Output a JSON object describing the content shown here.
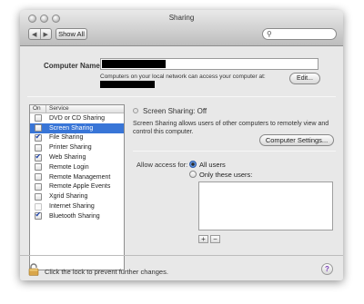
{
  "window": {
    "title": "Sharing"
  },
  "toolbar": {
    "back": "◀",
    "forward": "▶",
    "show_all_label": "Show All",
    "search_placeholder": ""
  },
  "computer_name": {
    "label": "Computer Name:",
    "help_text": "Computers on your local network can access your computer at:",
    "edit_label": "Edit..."
  },
  "services": {
    "header_on": "On",
    "header_service": "Service",
    "items": [
      {
        "label": "DVD or CD Sharing",
        "checked": false,
        "selected": false
      },
      {
        "label": "Screen Sharing",
        "checked": false,
        "selected": true
      },
      {
        "label": "File Sharing",
        "checked": true,
        "selected": false
      },
      {
        "label": "Printer Sharing",
        "checked": false,
        "selected": false
      },
      {
        "label": "Web Sharing",
        "checked": true,
        "selected": false
      },
      {
        "label": "Remote Login",
        "checked": false,
        "selected": false
      },
      {
        "label": "Remote Management",
        "checked": false,
        "selected": false
      },
      {
        "label": "Remote Apple Events",
        "checked": false,
        "selected": false
      },
      {
        "label": "Xgrid Sharing",
        "checked": false,
        "selected": false
      },
      {
        "label": "Internet Sharing",
        "checked": false,
        "selected": false
      },
      {
        "label": "Bluetooth Sharing",
        "checked": true,
        "selected": false
      }
    ]
  },
  "detail": {
    "status": "Screen Sharing: Off",
    "description": "Screen Sharing allows users of other computers to remotely view and control this computer.",
    "settings_label": "Computer Settings...",
    "allow_access_label": "Allow access for:",
    "option_all": "All users",
    "option_only": "Only these users:",
    "selected_option": "All users",
    "add_label": "+",
    "remove_label": "−"
  },
  "footer": {
    "lock_text": "Click the lock to prevent further changes.",
    "help_label": "?"
  },
  "colors": {
    "selection": "#3875d7",
    "check": "#1a3fa6",
    "help": "#7a3fb8"
  }
}
